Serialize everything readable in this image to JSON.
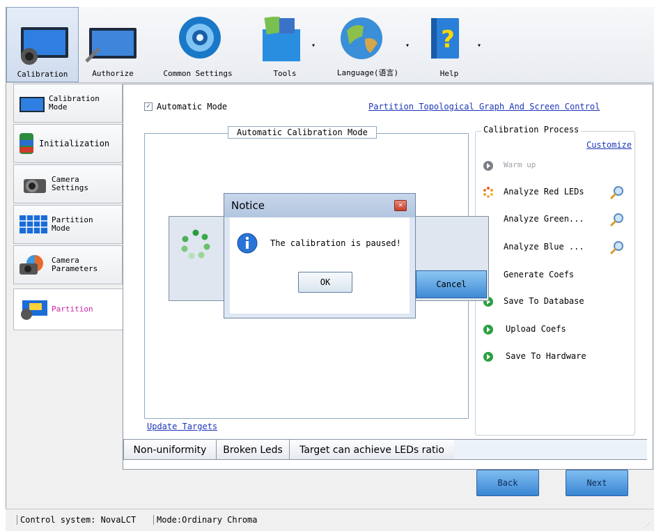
{
  "toolbar": {
    "items": [
      {
        "label": "Calibration"
      },
      {
        "label": "Authorize"
      },
      {
        "label": "Common Settings"
      },
      {
        "label": "Tools"
      },
      {
        "label": "Language(语言)"
      },
      {
        "label": "Help"
      }
    ]
  },
  "sidebar": {
    "items": [
      {
        "label": "Calibration\nMode",
        "l1": "Calibration",
        "l2": "Mode"
      },
      {
        "label": "Initialization"
      },
      {
        "l1": "Camera",
        "l2": "Settings"
      },
      {
        "l1": "Partition",
        "l2": "Mode"
      },
      {
        "l1": "Camera",
        "l2": "Parameters"
      },
      {
        "label": "Partition",
        "color": "#cc22aa"
      }
    ]
  },
  "main": {
    "automatic_mode_label": "Automatic Mode",
    "automatic_mode_checked": true,
    "topology_link": "Partition Topological Graph And Screen Control",
    "group_title": "Automatic Calibration Mode",
    "update_targets": "Update Targets",
    "process": {
      "title": "Calibration Process",
      "customize": "Customize",
      "steps": [
        {
          "label": "Warm up",
          "state": "done"
        },
        {
          "label": "Analyze Red LEDs",
          "state": "running"
        },
        {
          "label": "Analyze Green...",
          "state": "pending"
        },
        {
          "label": "Analyze Blue ...",
          "state": "pending"
        },
        {
          "label": "Generate Coefs",
          "state": "pending"
        },
        {
          "label": "Save To Database",
          "state": "pending"
        },
        {
          "label": "Upload Coefs",
          "state": "pending"
        },
        {
          "label": "Save To Hardware",
          "state": "pending"
        }
      ]
    },
    "tabs": [
      {
        "label": "Non-uniformity"
      },
      {
        "label": "Broken Leds"
      },
      {
        "label": "Target can achieve LEDs ratio"
      }
    ],
    "back": "Back",
    "next": "Next"
  },
  "progress_dialog": {
    "cancel": "Cancel"
  },
  "notice": {
    "title": "Notice",
    "message": "The calibration is paused!",
    "ok": "OK"
  },
  "statusbar": {
    "control_system": "Control system: NovaLCT",
    "mode": "Mode:Ordinary Chroma"
  },
  "colors": {
    "accent_blue": "#3a86d4",
    "link": "#1c36b8",
    "step_green": "#2aa040"
  }
}
